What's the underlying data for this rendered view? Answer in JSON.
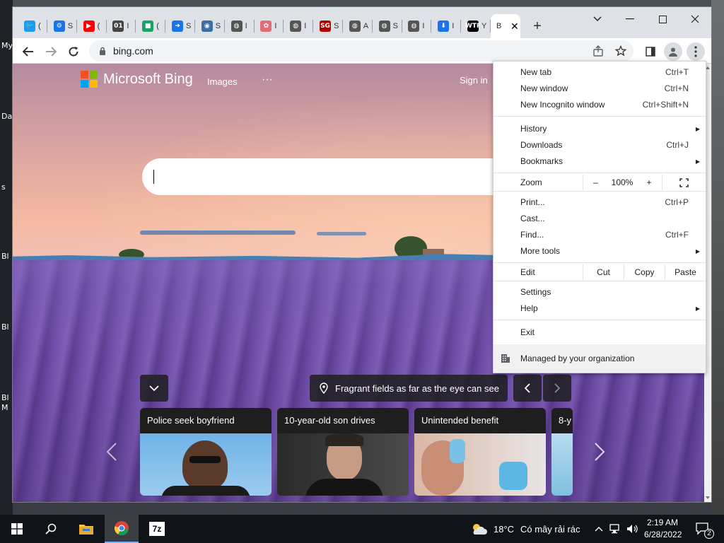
{
  "browser": {
    "tabs": [
      {
        "icon": "twitter-icon",
        "color": "#1d9bf0",
        "glyph": "🐦",
        "title": "("
      },
      {
        "icon": "gear-icon",
        "color": "#1a73e8",
        "glyph": "⚙",
        "title": "S"
      },
      {
        "icon": "youtube-icon",
        "color": "#ff0000",
        "glyph": "▶",
        "title": "("
      },
      {
        "icon": "binary-icon",
        "color": "#444444",
        "glyph": "01",
        "title": "I"
      },
      {
        "icon": "app-icon",
        "color": "#1aa260",
        "glyph": "■",
        "title": "("
      },
      {
        "icon": "arrow-icon",
        "color": "#1a73e8",
        "glyph": "➜",
        "title": "S"
      },
      {
        "icon": "globe-icon",
        "color": "#3b6ea5",
        "glyph": "◉",
        "title": "S"
      },
      {
        "icon": "globe-icon",
        "color": "#555555",
        "glyph": "◍",
        "title": "I"
      },
      {
        "icon": "flower-icon",
        "color": "#e06c75",
        "glyph": "✿",
        "title": "I"
      },
      {
        "icon": "globe-icon",
        "color": "#555555",
        "glyph": "◍",
        "title": "I"
      },
      {
        "icon": "sg-icon",
        "color": "#b00000",
        "glyph": "SG",
        "title": "S"
      },
      {
        "icon": "globe-icon",
        "color": "#555555",
        "glyph": "◍",
        "title": "A"
      },
      {
        "icon": "globe-icon",
        "color": "#555555",
        "glyph": "◍",
        "title": "S"
      },
      {
        "icon": "globe-icon",
        "color": "#555555",
        "glyph": "◍",
        "title": "I"
      },
      {
        "icon": "download-icon",
        "color": "#1a73e8",
        "glyph": "⬇",
        "title": "I"
      },
      {
        "icon": "wtf-icon",
        "color": "#000000",
        "glyph": "WTF",
        "title": "Y"
      }
    ],
    "active_tab_title": "B",
    "url": "bing.com"
  },
  "bing": {
    "brand": "Microsoft Bing",
    "images_link": "Images",
    "more_link": "···",
    "signin": "Sign in",
    "caption": "Fragrant fields as far as the eye can see",
    "news": [
      {
        "title": "Police seek boyfriend"
      },
      {
        "title": "10-year-old son drives"
      },
      {
        "title": "Unintended benefit"
      },
      {
        "title": "8-y"
      }
    ]
  },
  "menu": {
    "new_tab": "New tab",
    "new_tab_sc": "Ctrl+T",
    "new_window": "New window",
    "new_window_sc": "Ctrl+N",
    "new_incognito": "New Incognito window",
    "new_incognito_sc": "Ctrl+Shift+N",
    "history": "History",
    "downloads": "Downloads",
    "downloads_sc": "Ctrl+J",
    "bookmarks": "Bookmarks",
    "zoom": "Zoom",
    "zoom_minus": "–",
    "zoom_value": "100%",
    "zoom_plus": "+",
    "print": "Print...",
    "print_sc": "Ctrl+P",
    "cast": "Cast...",
    "find": "Find...",
    "find_sc": "Ctrl+F",
    "more_tools": "More tools",
    "edit": "Edit",
    "cut": "Cut",
    "copy": "Copy",
    "paste": "Paste",
    "settings": "Settings",
    "help": "Help",
    "exit": "Exit",
    "managed": "Managed by your organization"
  },
  "desktop": {
    "labels": [
      "My",
      "Da",
      "s",
      "Bl",
      "Bl",
      "Bl",
      "M"
    ]
  },
  "taskbar": {
    "weather_temp": "18°C",
    "weather_desc": "Có mây rải rác",
    "time": "2:19 AM",
    "date": "6/28/2022",
    "notif_count": "2",
    "app_7z": "7z"
  }
}
